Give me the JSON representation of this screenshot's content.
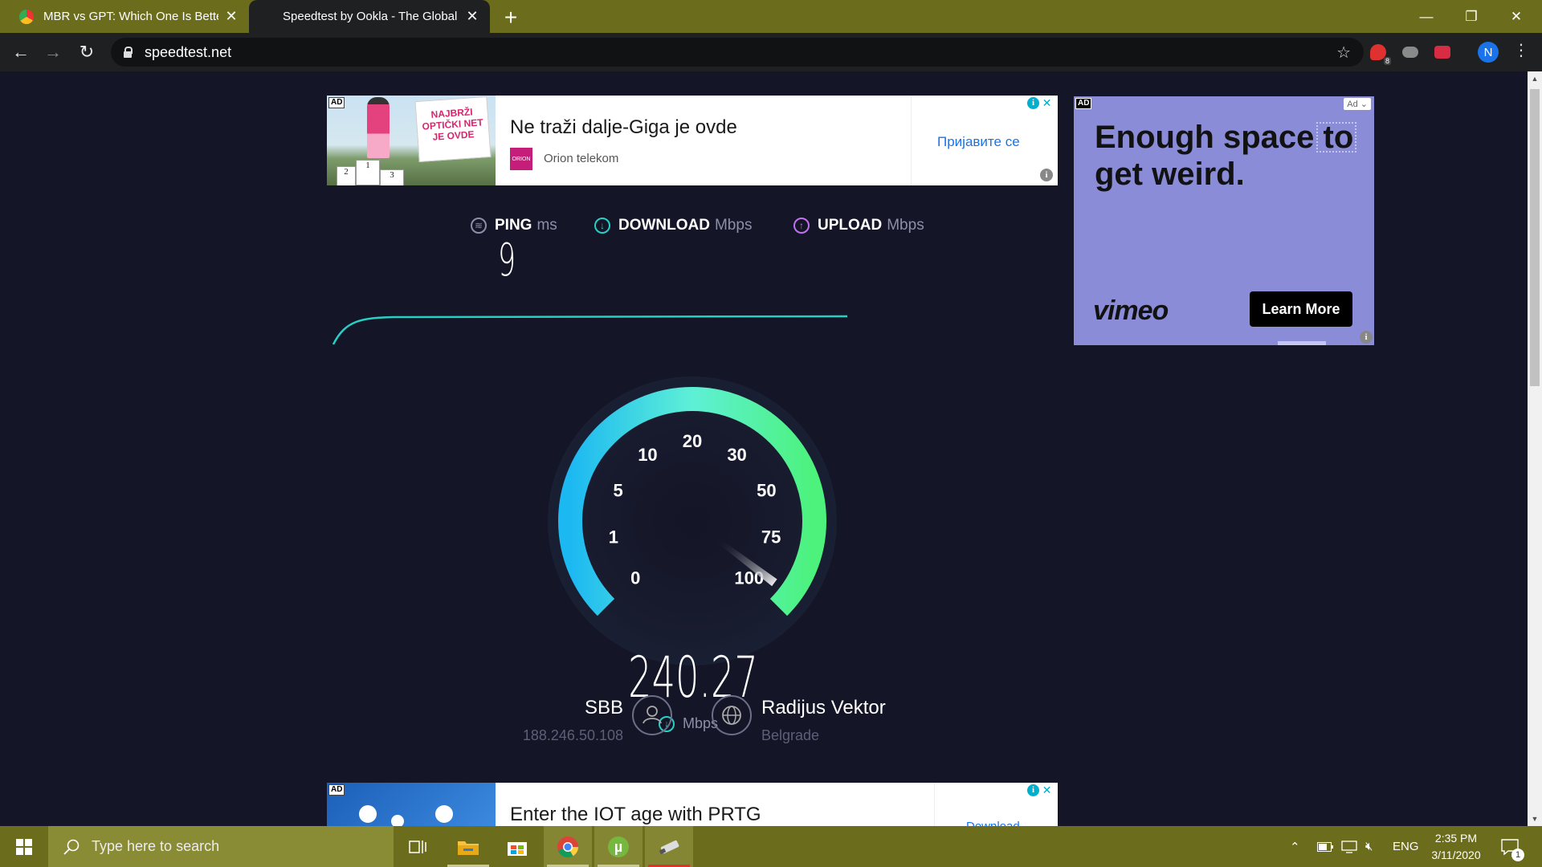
{
  "browser": {
    "tabs": [
      {
        "title": "MBR vs GPT: Which One Is Better",
        "active": false
      },
      {
        "title": "Speedtest by Ookla - The Global",
        "active": true
      }
    ],
    "new_tab": "+",
    "url": "speedtest.net",
    "profile_initial": "N",
    "extension_badge": "8"
  },
  "ad_top": {
    "label": "AD",
    "headline": "Ne traži dalje-Giga je ovde",
    "brand": "Orion telekom",
    "brand_logo": "ORION",
    "cta": "Пријавите се",
    "sign_text": "NAJBRŽI OPTIČKI NET JE OVDE",
    "podium": [
      "2",
      "1",
      "3"
    ]
  },
  "ad_right": {
    "label": "AD",
    "headline": "Enough space to get weird.",
    "logo": "vimeo",
    "cta": "Learn More",
    "ad_choice": "Ad"
  },
  "metrics": {
    "ping": {
      "label": "PING",
      "unit": "ms",
      "value": "9"
    },
    "download": {
      "label": "DOWNLOAD",
      "unit": "Mbps"
    },
    "upload": {
      "label": "UPLOAD",
      "unit": "Mbps"
    }
  },
  "gauge": {
    "value": "240.27",
    "unit": "Mbps",
    "ticks": [
      "0",
      "1",
      "5",
      "10",
      "20",
      "30",
      "50",
      "75",
      "100"
    ],
    "needle_fraction": 0.97
  },
  "isp": {
    "name": "SBB",
    "ip": "188.246.50.108"
  },
  "server": {
    "name": "Radijus Vektor",
    "location": "Belgrade"
  },
  "ad_bottom": {
    "label": "AD",
    "headline": "Enter the IOT age with PRTG",
    "cta": "Download"
  },
  "taskbar": {
    "search_placeholder": "Type here to search",
    "language": "ENG",
    "time": "2:35 PM",
    "date": "3/11/2020",
    "notification_count": "1"
  },
  "colors": {
    "page_bg": "#141526",
    "accent_cyan": "#27d0c5",
    "accent_purple": "#c171f0",
    "gauge_start": "#1cb8f2",
    "gauge_end": "#4cf27b",
    "taskbar": "#6b6c1c"
  }
}
